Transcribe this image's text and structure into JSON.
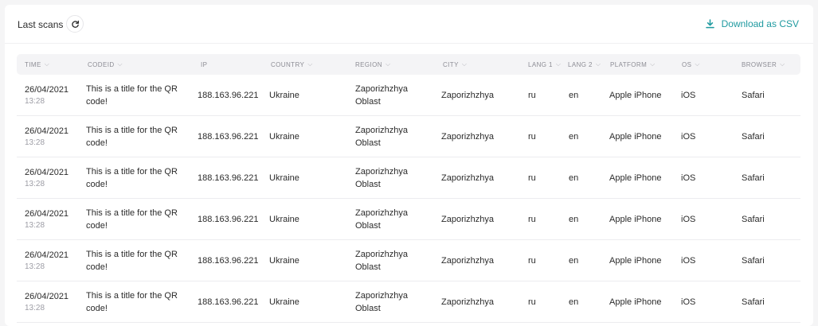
{
  "header": {
    "title": "Last scans",
    "refresh_icon": "refresh-icon",
    "download_label": "Download as CSV",
    "download_icon": "download-icon",
    "accent_color": "#1f9aa0"
  },
  "table": {
    "columns": [
      "TIME",
      "CODEID",
      "IP",
      "COUNTRY",
      "REGION",
      "CITY",
      "LANG 1",
      "LANG 2",
      "PLATFORM",
      "OS",
      "BROWSER"
    ],
    "rows": [
      {
        "date": "26/04/2021",
        "time": "13:28",
        "code": "This is a title for the QR code!",
        "ip": "188.163.96.221",
        "country": "Ukraine",
        "region": "Zaporizhzhya Oblast",
        "city": "Zaporizhzhya",
        "lang1": "ru",
        "lang2": "en",
        "platform": "Apple iPhone",
        "os": "iOS",
        "browser": "Safari"
      },
      {
        "date": "26/04/2021",
        "time": "13:28",
        "code": "This is a title for the QR code!",
        "ip": "188.163.96.221",
        "country": "Ukraine",
        "region": "Zaporizhzhya Oblast",
        "city": "Zaporizhzhya",
        "lang1": "ru",
        "lang2": "en",
        "platform": "Apple iPhone",
        "os": "iOS",
        "browser": "Safari"
      },
      {
        "date": "26/04/2021",
        "time": "13:28",
        "code": "This is a title for the QR code!",
        "ip": "188.163.96.221",
        "country": "Ukraine",
        "region": "Zaporizhzhya Oblast",
        "city": "Zaporizhzhya",
        "lang1": "ru",
        "lang2": "en",
        "platform": "Apple iPhone",
        "os": "iOS",
        "browser": "Safari"
      },
      {
        "date": "26/04/2021",
        "time": "13:28",
        "code": "This is a title for the QR code!",
        "ip": "188.163.96.221",
        "country": "Ukraine",
        "region": "Zaporizhzhya Oblast",
        "city": "Zaporizhzhya",
        "lang1": "ru",
        "lang2": "en",
        "platform": "Apple iPhone",
        "os": "iOS",
        "browser": "Safari"
      },
      {
        "date": "26/04/2021",
        "time": "13:28",
        "code": "This is a title for the QR code!",
        "ip": "188.163.96.221",
        "country": "Ukraine",
        "region": "Zaporizhzhya Oblast",
        "city": "Zaporizhzhya",
        "lang1": "ru",
        "lang2": "en",
        "platform": "Apple iPhone",
        "os": "iOS",
        "browser": "Safari"
      },
      {
        "date": "26/04/2021",
        "time": "13:28",
        "code": "This is a title for the QR code!",
        "ip": "188.163.96.221",
        "country": "Ukraine",
        "region": "Zaporizhzhya Oblast",
        "city": "Zaporizhzhya",
        "lang1": "ru",
        "lang2": "en",
        "platform": "Apple iPhone",
        "os": "iOS",
        "browser": "Safari"
      }
    ]
  }
}
